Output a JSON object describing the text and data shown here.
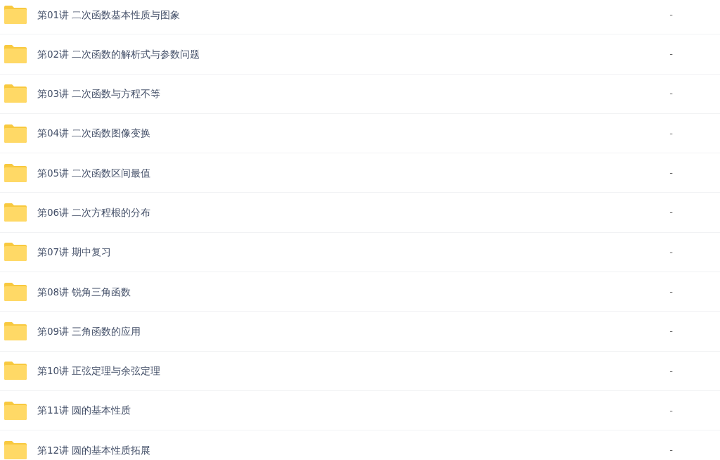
{
  "files": [
    {
      "name": "第01讲 二次函数基本性质与图象",
      "size": "-"
    },
    {
      "name": "第02讲 二次函数的解析式与参数问题",
      "size": "-"
    },
    {
      "name": "第03讲 二次函数与方程不等",
      "size": "-"
    },
    {
      "name": "第04讲 二次函数图像变换",
      "size": "-"
    },
    {
      "name": "第05讲 二次函数区间最值",
      "size": "-"
    },
    {
      "name": "第06讲 二次方程根的分布",
      "size": "-"
    },
    {
      "name": "第07讲 期中复习",
      "size": "-"
    },
    {
      "name": "第08讲 锐角三角函数",
      "size": "-"
    },
    {
      "name": "第09讲 三角函数的应用",
      "size": "-"
    },
    {
      "name": "第10讲 正弦定理与余弦定理",
      "size": "-"
    },
    {
      "name": "第11讲 圆的基本性质",
      "size": "-"
    },
    {
      "name": "第12讲 圆的基本性质拓展",
      "size": "-"
    }
  ]
}
